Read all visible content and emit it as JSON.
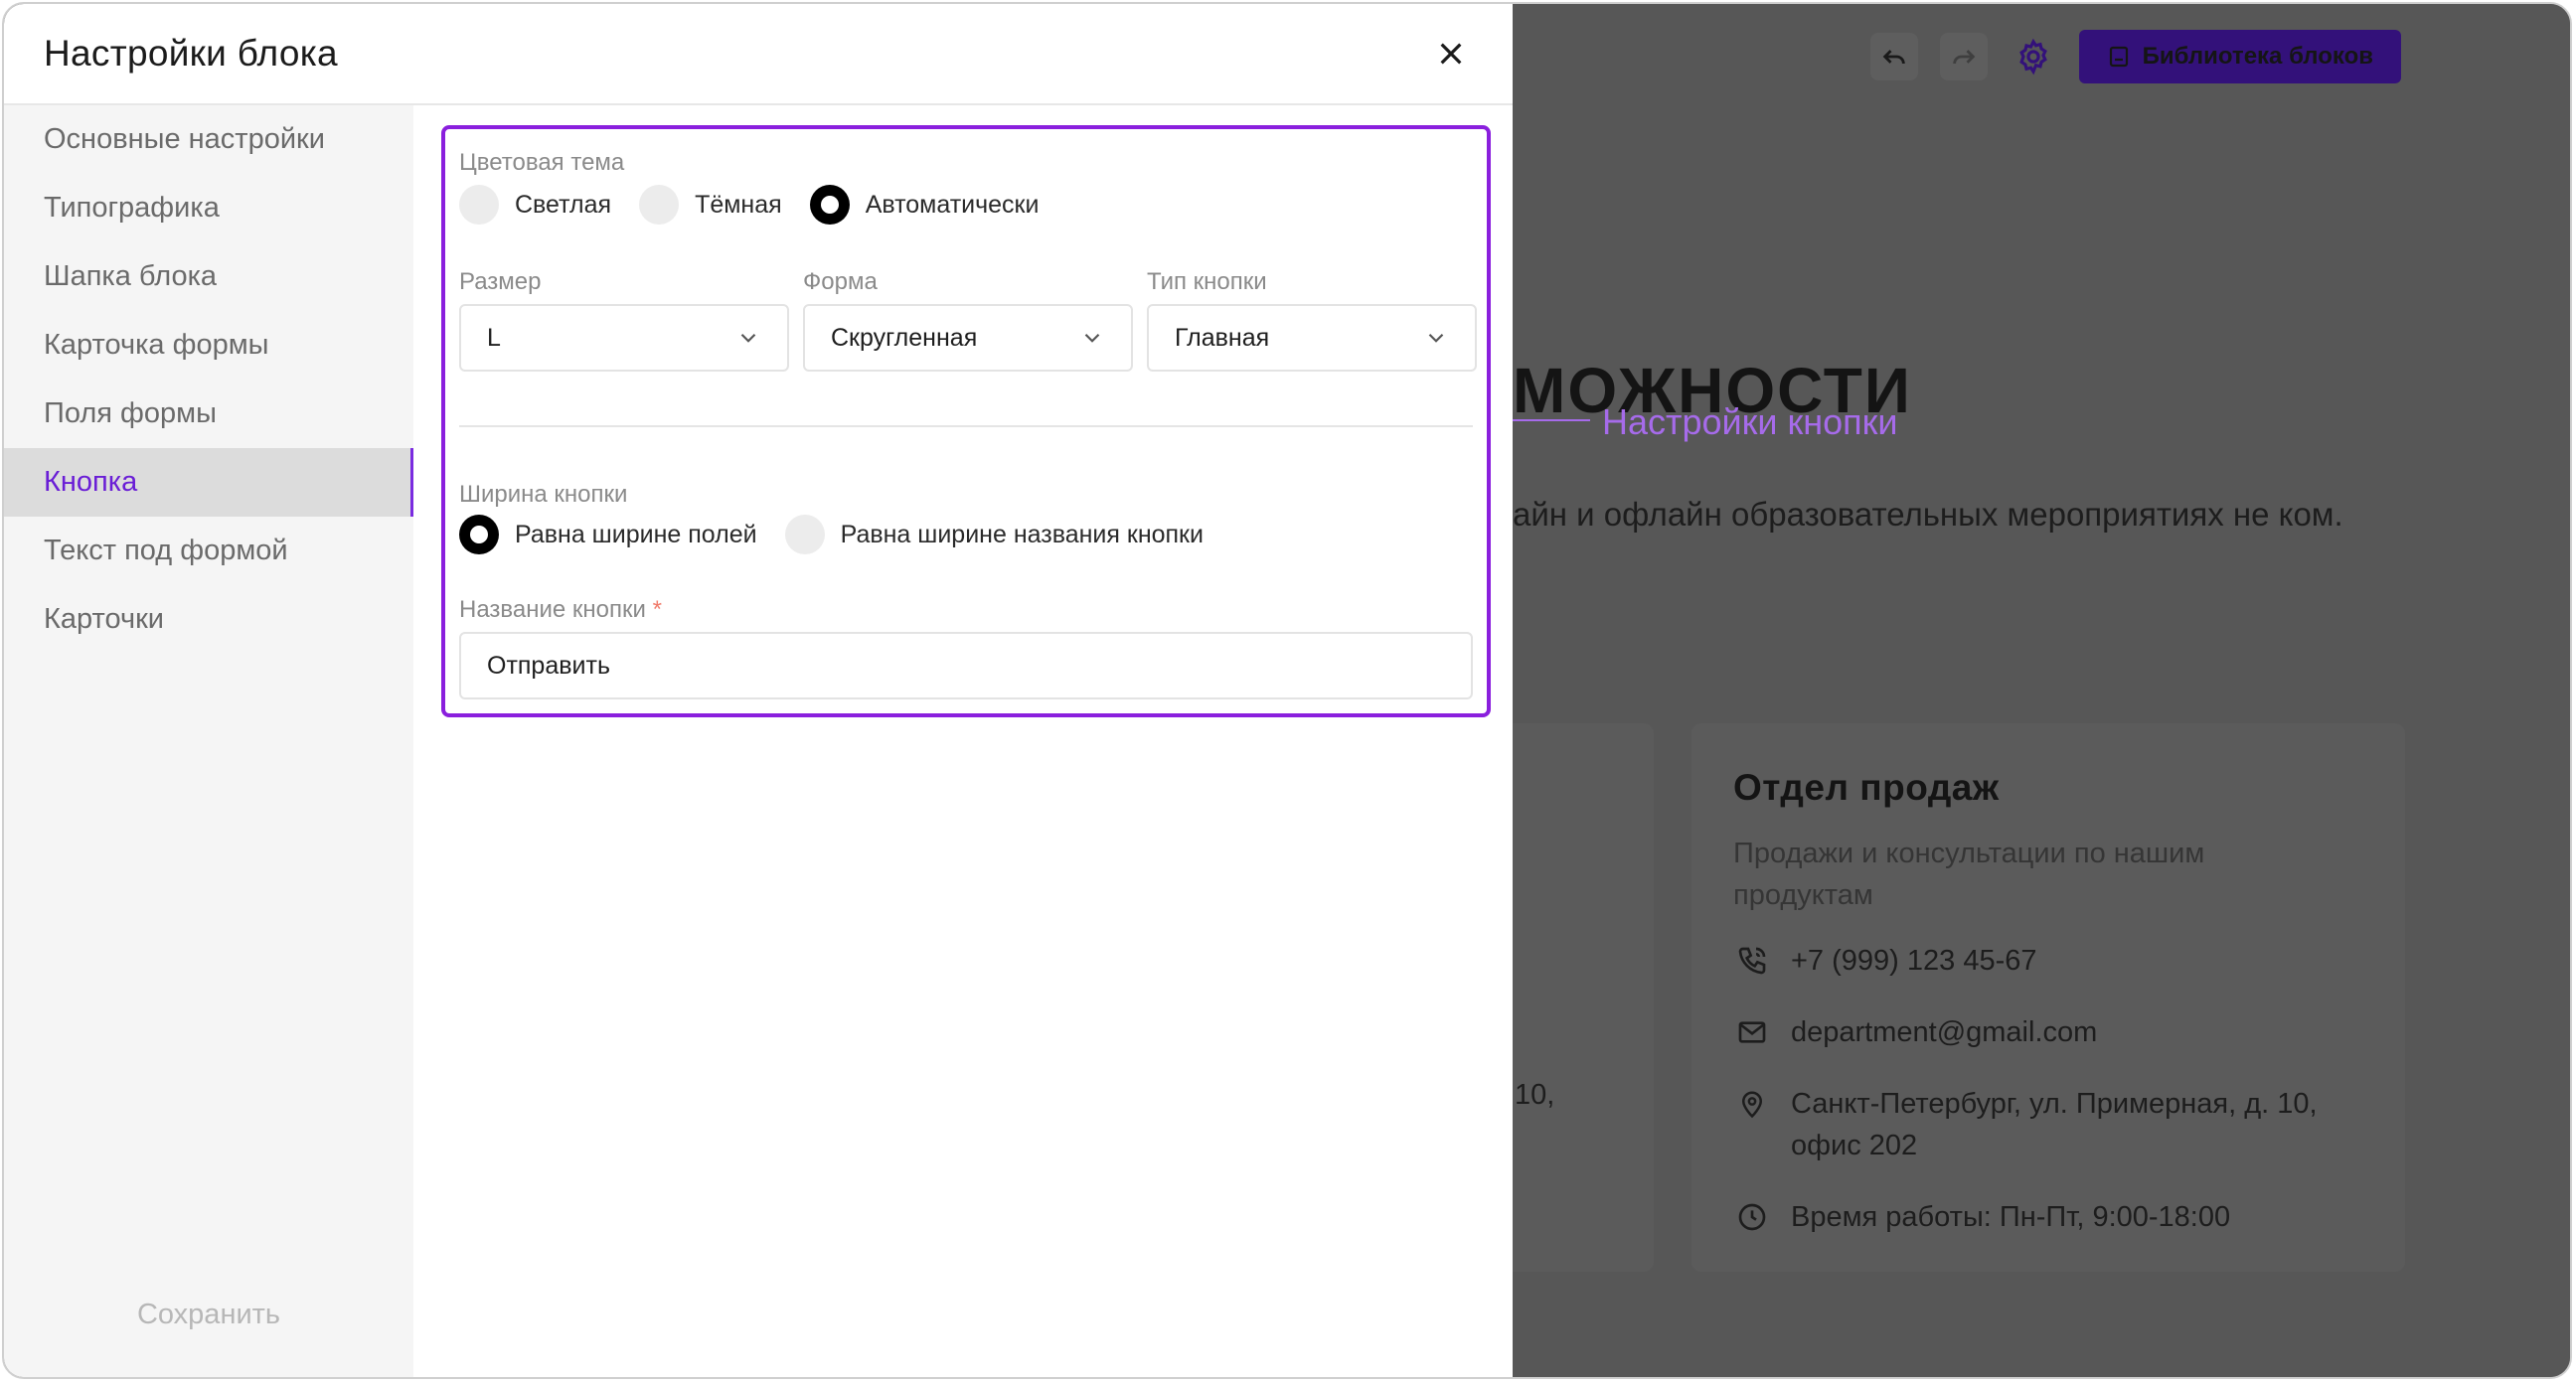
{
  "modal": {
    "title": "Настройки блока",
    "nav": [
      {
        "label": "Основные настройки",
        "active": false
      },
      {
        "label": "Типографика",
        "active": false
      },
      {
        "label": "Шапка блока",
        "active": false
      },
      {
        "label": "Карточка формы",
        "active": false
      },
      {
        "label": "Поля формы",
        "active": false
      },
      {
        "label": "Кнопка",
        "active": true
      },
      {
        "label": "Текст под формой",
        "active": false
      },
      {
        "label": "Карточки",
        "active": false
      }
    ],
    "save_label": "Сохранить"
  },
  "button_settings": {
    "theme": {
      "label": "Цветовая тема",
      "options": [
        "Светлая",
        "Тёмная",
        "Автоматически"
      ],
      "selected": "Автоматически"
    },
    "size": {
      "label": "Размер",
      "value": "L"
    },
    "shape": {
      "label": "Форма",
      "value": "Скругленная"
    },
    "type": {
      "label": "Тип кнопки",
      "value": "Главная"
    },
    "width": {
      "label": "Ширина кнопки",
      "options": [
        "Равна ширине полей",
        "Равна ширине названия кнопки"
      ],
      "selected": "Равна ширине полей"
    },
    "name": {
      "label": "Название кнопки",
      "required_mark": "*",
      "value": "Отправить"
    }
  },
  "annotation": {
    "text": "Настройки кнопки",
    "color": "#a66bea"
  },
  "background_page": {
    "library_button": "Библиотека блоков",
    "hero_title_fragment": "МОЖНОСТИ",
    "hero_text": "айн и офлайн образовательных мероприятиях не ком.",
    "left_card_fragment": "10,",
    "sales_card": {
      "title": "Отдел продаж",
      "subtitle": "Продажи и консультации по нашим продуктам",
      "phone": "+7 (999) 123 45-67",
      "email": "department@gmail.com",
      "address": "Санкт-Петербург, ул. Примерная, д. 10, офис 202",
      "hours": "Время работы: Пн-Пт, 9:00-18:00"
    }
  },
  "colors": {
    "accent": "#8a1fdd",
    "active_nav_text": "#6a1ed6",
    "library_button_bg": "#33117a"
  },
  "icons": [
    "close-icon",
    "chevron-down-icon",
    "undo-icon",
    "redo-icon",
    "gear-icon",
    "library-icon",
    "phone-icon",
    "mail-icon",
    "pin-icon",
    "clock-icon"
  ]
}
